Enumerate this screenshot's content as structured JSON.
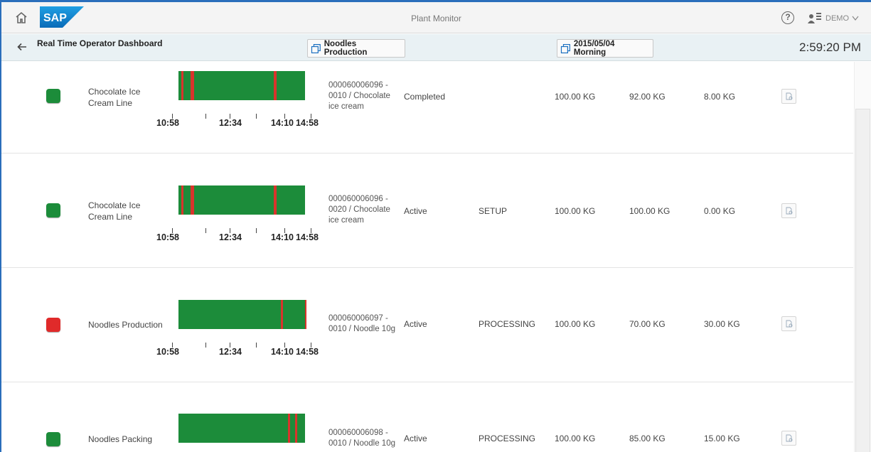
{
  "shell": {
    "title": "Plant Monitor",
    "logo_text": "SAP",
    "help_symbol": "?",
    "user_name": "DEMO"
  },
  "header": {
    "title": "Real Time Operator Dashboard",
    "line_button_label": "Noodles Production",
    "shift_button_label": "2015/05/04 Morning",
    "clock": "2:59:20 PM"
  },
  "colors": {
    "status_green": "#1c8c3a",
    "status_red": "#e02a2a",
    "timeline_green": "#1c8c3a",
    "timeline_event_red": "#d8342c"
  },
  "icons": {
    "home": "home-icon",
    "help": "help-icon",
    "user": "user-icon",
    "back": "back-arrow-icon",
    "copy": "copy-icon",
    "detail": "document-search-icon"
  },
  "rows": [
    {
      "status": "green",
      "line": "Chocolate Ice Cream Line",
      "order": "000060006096 - 0010 / Chocolate ice cream",
      "order_status": "Completed",
      "phase": "",
      "planned": "100.00 KG",
      "actual": "92.00 KG",
      "remaining": "8.00 KG",
      "ticks": [
        "10:58",
        "12:34",
        "14:10",
        "14:58"
      ]
    },
    {
      "status": "green",
      "line": "Chocolate Ice Cream Line",
      "order": "000060006096 - 0020 / Chocolate ice cream",
      "order_status": "Active",
      "phase": "SETUP",
      "planned": "100.00 KG",
      "actual": "100.00 KG",
      "remaining": "0.00 KG",
      "ticks": [
        "10:58",
        "12:34",
        "14:10",
        "14:58"
      ]
    },
    {
      "status": "red",
      "line": "Noodles Production",
      "order": "000060006097 - 0010 / Noodle 10g",
      "order_status": "Active",
      "phase": "PROCESSING",
      "planned": "100.00 KG",
      "actual": "70.00 KG",
      "remaining": "30.00 KG",
      "ticks": [
        "10:58",
        "12:34",
        "14:10",
        "14:58"
      ]
    },
    {
      "status": "green",
      "line": "Noodles Packing",
      "order": "000060006098 - 0010 / Noodle 10g",
      "order_status": "Active",
      "phase": "PROCESSING",
      "planned": "100.00 KG",
      "actual": "85.00 KG",
      "remaining": "15.00 KG",
      "ticks": []
    }
  ]
}
